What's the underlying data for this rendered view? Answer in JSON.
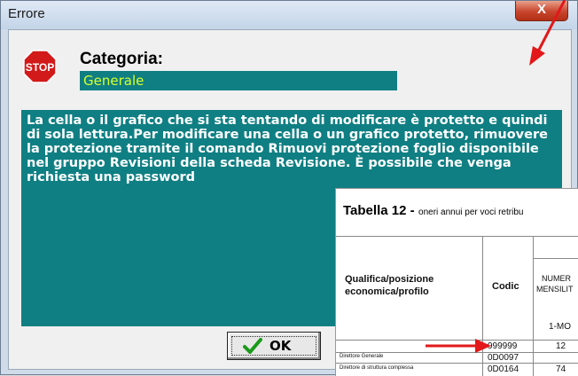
{
  "window": {
    "title": "Errore",
    "close_glyph": "X"
  },
  "category": {
    "label": "Categoria:",
    "value": "Generale",
    "icon_text": "STOP"
  },
  "message_lines": [
    "La cella o il grafico che si sta tentando di modificare è protetto e quindi",
    "di sola lettura.Per modificare una cella o un grafico protetto, rimuovere",
    "la protezione tramite il comando Rimuovi protezione foglio disponibile",
    "nel gruppo Revisioni della scheda Revisione. È possibile che venga",
    "richiesta una password"
  ],
  "ok_button": {
    "label": "OK"
  },
  "overlay_table": {
    "title_bold": "Tabella 12 -",
    "title_rest": "oneri annui per voci retribu",
    "col_qualifica": [
      "Qualifica/posizione",
      "economica/profilo"
    ],
    "col_codice": "Codic",
    "col_numero": [
      "NUMER",
      "MENSILIT"
    ],
    "col_subheader": "1-MO",
    "rows": [
      {
        "name": "",
        "code": "999999",
        "num": "12"
      },
      {
        "name": "Direttore Generale",
        "code": "0D0097",
        "num": ""
      },
      {
        "name": "Direttore di struttura complessa",
        "code": "0D0164",
        "num": "74"
      }
    ]
  },
  "colors": {
    "teal": "#0f7f83",
    "arrow_red": "#e2181a",
    "category_text": "#d7ff2a"
  }
}
